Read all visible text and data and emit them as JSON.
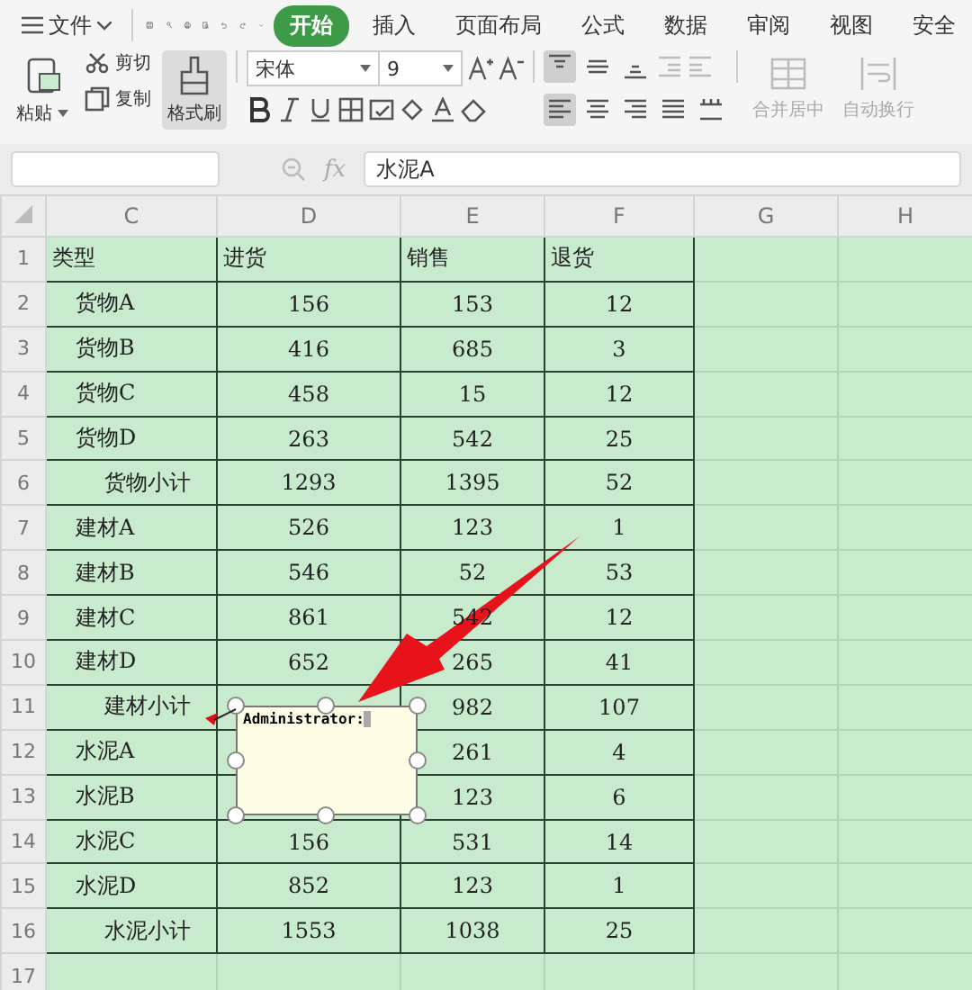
{
  "menu": {
    "label": "文件"
  },
  "tabs": [
    {
      "label": "开始",
      "selected": true
    },
    {
      "label": "插入",
      "selected": false
    },
    {
      "label": "页面布局",
      "selected": false
    },
    {
      "label": "公式",
      "selected": false
    },
    {
      "label": "数据",
      "selected": false
    },
    {
      "label": "审阅",
      "selected": false
    },
    {
      "label": "视图",
      "selected": false
    },
    {
      "label": "安全",
      "selected": false
    }
  ],
  "clipboard": {
    "paste": "粘贴",
    "cut": "剪切",
    "copy": "复制",
    "format_painter": {
      "label": "格式刷",
      "selected": true
    }
  },
  "font": {
    "name": "宋体",
    "size": "9"
  },
  "vertical_align": [
    {
      "selected": true
    },
    {
      "selected": false
    },
    {
      "selected": false
    }
  ],
  "horizontal_align": [
    {
      "selected": true
    },
    {
      "selected": false
    },
    {
      "selected": false
    },
    {
      "selected": false
    },
    {
      "selected": false
    }
  ],
  "merge": {
    "label": "合并居中",
    "disabled": true
  },
  "wrap": {
    "label": "自动换行",
    "disabled": true
  },
  "formula_bar": {
    "fx_label": "fx",
    "formula": "水泥A"
  },
  "sheet": {
    "columns": [
      "C",
      "D",
      "E",
      "F",
      "G",
      "H"
    ],
    "rows": [
      {
        "number": "1",
        "kind": "header",
        "cells": {
          "C": "类型",
          "D": "进货",
          "E": "销售",
          "F": "退货"
        }
      },
      {
        "number": "2",
        "kind": "item",
        "cells": {
          "C": "货物A",
          "D": "156",
          "E": "153",
          "F": "12"
        }
      },
      {
        "number": "3",
        "kind": "item",
        "cells": {
          "C": "货物B",
          "D": "416",
          "E": "685",
          "F": "3"
        }
      },
      {
        "number": "4",
        "kind": "item",
        "cells": {
          "C": "货物C",
          "D": "458",
          "E": "15",
          "F": "12"
        }
      },
      {
        "number": "5",
        "kind": "item",
        "cells": {
          "C": "货物D",
          "D": "263",
          "E": "542",
          "F": "25"
        }
      },
      {
        "number": "6",
        "kind": "subtotal",
        "cells": {
          "C": "货物小计",
          "D": "1293",
          "E": "1395",
          "F": "52"
        }
      },
      {
        "number": "7",
        "kind": "item",
        "cells": {
          "C": "建材A",
          "D": "526",
          "E": "123",
          "F": "1"
        }
      },
      {
        "number": "8",
        "kind": "item",
        "cells": {
          "C": "建材B",
          "D": "546",
          "E": "52",
          "F": "53"
        }
      },
      {
        "number": "9",
        "kind": "item",
        "cells": {
          "C": "建材C",
          "D": "861",
          "E": "542",
          "F": "12"
        }
      },
      {
        "number": "10",
        "kind": "item",
        "cells": {
          "C": "建材D",
          "D": "652",
          "E": "265",
          "F": "41"
        }
      },
      {
        "number": "11",
        "kind": "subtotal",
        "cells": {
          "C": "建材小计",
          "E": "982",
          "F": "107"
        }
      },
      {
        "number": "12",
        "kind": "item",
        "cells": {
          "C": "水泥A",
          "E": "261",
          "F": "4"
        }
      },
      {
        "number": "13",
        "kind": "item",
        "cells": {
          "C": "水泥B",
          "E": "123",
          "F": "6"
        }
      },
      {
        "number": "14",
        "kind": "item",
        "cells": {
          "C": "水泥C",
          "D": "156",
          "E": "531",
          "F": "14"
        }
      },
      {
        "number": "15",
        "kind": "item",
        "cells": {
          "C": "水泥D",
          "D": "852",
          "E": "123",
          "F": "1"
        }
      },
      {
        "number": "16",
        "kind": "subtotal",
        "cells": {
          "C": "水泥小计",
          "D": "1553",
          "E": "1038",
          "F": "25"
        }
      },
      {
        "number": "17",
        "kind": "blank",
        "cells": {}
      }
    ]
  },
  "comment": {
    "author": "Administrator:"
  }
}
